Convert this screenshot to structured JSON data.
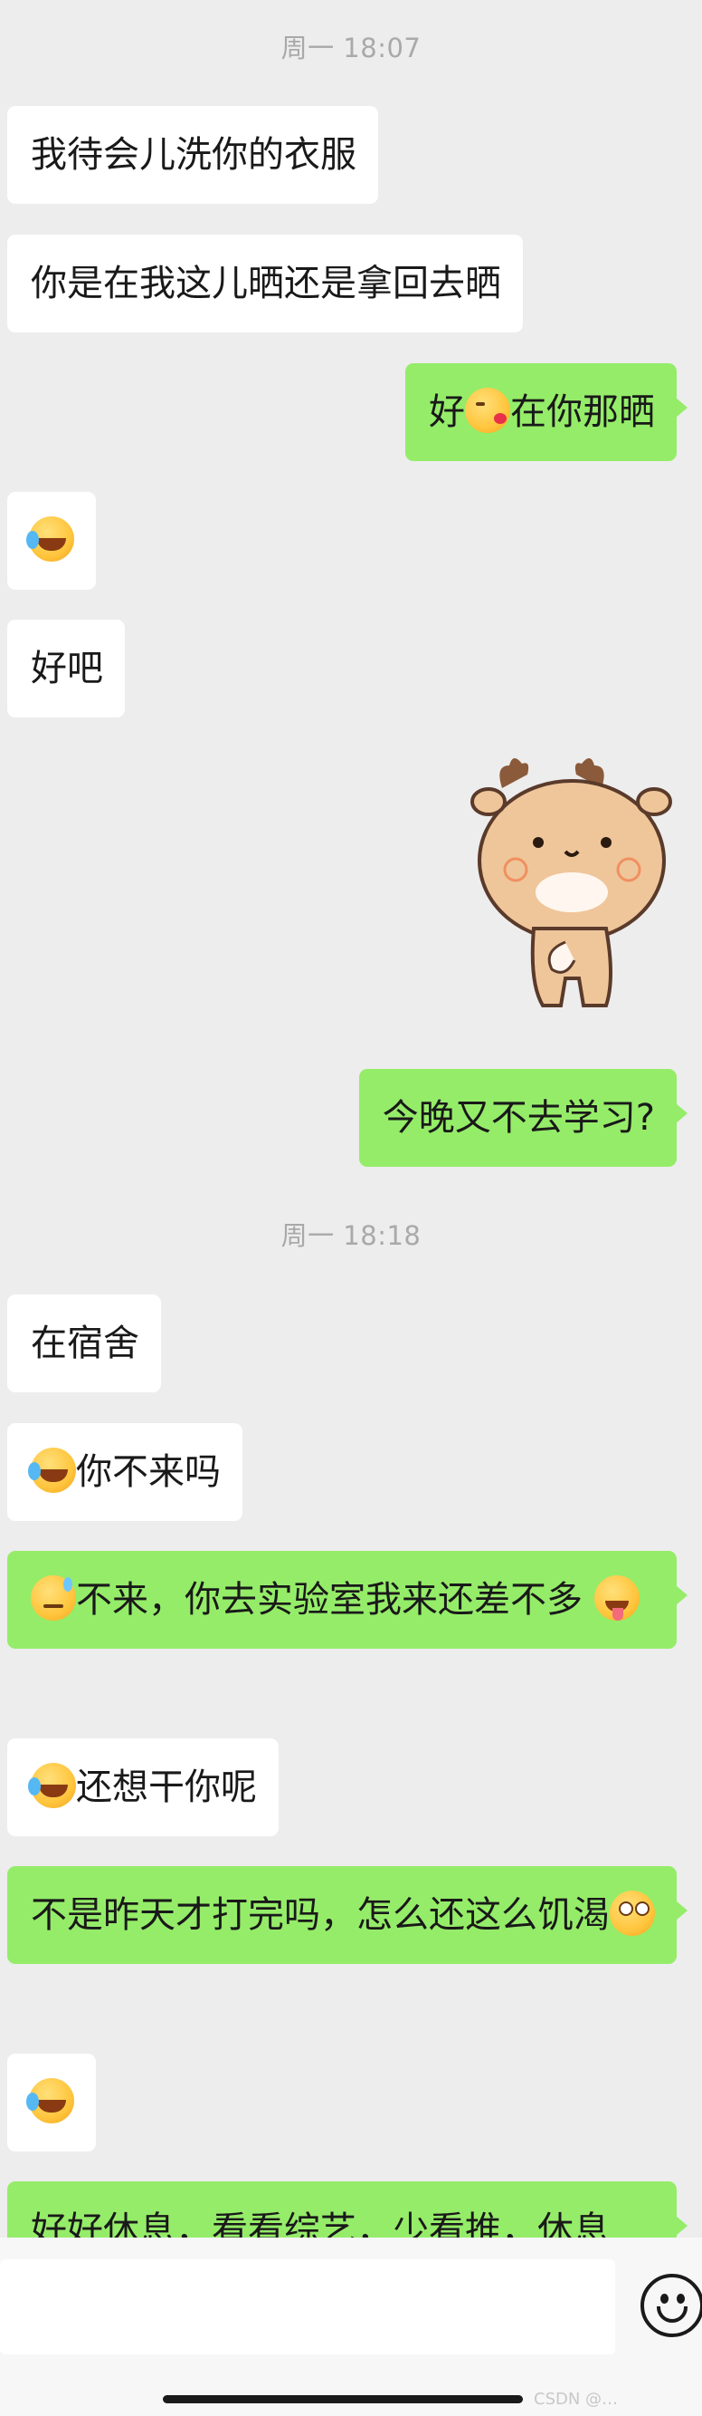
{
  "chat": {
    "timestamps": [
      "周一 18:07",
      "周一 18:18"
    ],
    "messages": [
      {
        "side": "in",
        "text": "我待会儿洗你的衣服"
      },
      {
        "side": "in",
        "text": "你是在我这儿晒还是拿回去晒"
      },
      {
        "side": "out",
        "text_before": "好",
        "emoji": "kiss-emoji",
        "text_after": "在你那晒"
      },
      {
        "side": "in",
        "emoji": "laugh-cry-emoji"
      },
      {
        "side": "in",
        "text": "好吧"
      },
      {
        "side": "out",
        "sticker": "deer-sticker"
      },
      {
        "side": "out",
        "text": "今晚又不去学习?"
      },
      {
        "side": "in",
        "text": "在宿舍"
      },
      {
        "side": "in",
        "emoji": "laugh-cry-emoji",
        "text": "你不来吗"
      },
      {
        "side": "out",
        "emoji": "sweat-emoji",
        "text": "不来，你去实验室我来还差不多",
        "emoji_end": "drool-emoji"
      },
      {
        "side": "in",
        "emoji": "laugh-cry-emoji",
        "text": "还想干你呢"
      },
      {
        "side": "out",
        "text": "不是昨天才打完吗，怎么还这么饥渴",
        "emoji_end": "eye-roll-emoji"
      },
      {
        "side": "in",
        "emoji": "laugh-cry-emoji"
      },
      {
        "side": "out",
        "text": "好好休息，看看综艺，少看推，休息"
      }
    ]
  },
  "input_bar": {
    "value": "",
    "emoji_button": "smiley-icon"
  },
  "watermark": "CSDN @…",
  "colors": {
    "background": "#ededed",
    "incoming": "#ffffff",
    "outgoing": "#95ec69",
    "timestamp": "#a9a9a9"
  }
}
